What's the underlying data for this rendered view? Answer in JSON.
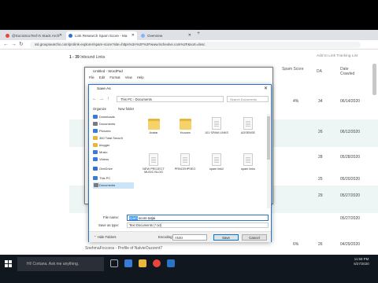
{
  "browser": {
    "tabs": [
      {
        "label": "@SocioSocTech's Stack Arch",
        "active": false,
        "color": "#e8453c"
      },
      {
        "label": "Link Research Spam Score - Ma",
        "active": true,
        "color": "#2f6fd6"
      },
      {
        "label": "Overview",
        "active": false,
        "color": "#8ab4f8"
      }
    ],
    "url": "ssl.groupsearchs.com/prolink-explorer/spam-score?site=https%3A%2F%2Fwww.lscheolve.com%2F&sort=desc"
  },
  "page": {
    "count_range": "1 - 39",
    "count_label": "Inbound Links",
    "add_button": "Add to Link Tracking List",
    "columns": [
      {
        "label": "Spam Score"
      },
      {
        "label": "DA"
      },
      {
        "label": "Date Crawled"
      }
    ],
    "rows": [
      {
        "spam": "4%",
        "da": "34",
        "date": "06/14/2020"
      },
      {
        "spam": "",
        "da": "26",
        "date": "06/12/2020"
      },
      {
        "spam": "",
        "da": "28",
        "date": "05/28/2020"
      },
      {
        "spam": "",
        "da": "25",
        "date": "05/20/2020"
      },
      {
        "spam": "",
        "da": "29",
        "date": "05/27/2020"
      },
      {
        "spam": "",
        "da": "",
        "date": "05/27/2020"
      },
      {
        "spam": "6%",
        "da": "26",
        "date": "04/29/2020"
      }
    ],
    "bottom_row_text": "SnehmaFoccess - Profile of NalvieOuzzent7"
  },
  "wordpad": {
    "title": "Untitled - WordPad",
    "menu": [
      "File",
      "Edit",
      "Format",
      "View",
      "Help"
    ]
  },
  "save_as": {
    "title": "Save As",
    "path": [
      "This PC",
      "Documents"
    ],
    "search_placeholder": "Search Documents",
    "organize": "Organize",
    "new_folder": "New folder",
    "nav_items": [
      {
        "label": "Downloads",
        "color": "#3a7bd5"
      },
      {
        "label": "Documents",
        "color": "#7a7a7a"
      },
      {
        "label": "Pictures",
        "color": "#3a7bd5"
      },
      {
        "label": "360 Total Securit",
        "color": "#e8b63c"
      },
      {
        "label": "blogger",
        "color": "#e8b63c"
      },
      {
        "label": "Music",
        "color": "#3a7bd5"
      },
      {
        "label": "Videos",
        "color": "#3a7bd5"
      },
      {
        "label": "OneDrive",
        "color": "#2f6fd6"
      },
      {
        "label": "This PC",
        "color": "#3a7bd5"
      },
      {
        "label": "Documents",
        "color": "#7a7a7a",
        "selected": true
      }
    ],
    "files": [
      {
        "label": "Avatar",
        "kind": "folder"
      },
      {
        "label": "Youcam",
        "kind": "folder"
      },
      {
        "label": "101 SPAM LINKS",
        "kind": "doc"
      },
      {
        "label": "ADSENSE",
        "kind": "doc"
      },
      {
        "label": "NEW PROJECT MUSIC BLOG",
        "kind": "doc"
      },
      {
        "label": "PRNCEHPSEO",
        "kind": "doc"
      },
      {
        "label": "spam link2",
        "kind": "doc"
      },
      {
        "label": "spam links",
        "kind": "doc"
      }
    ],
    "file_name_label": "File name:",
    "file_name_selected": "spam",
    "file_name_rest": " score tatjai",
    "save_type_label": "Save as type:",
    "save_type": "Text Documents (*.txt)",
    "hide_folders": "Hide Folders",
    "encoding_label": "Encoding:",
    "encoding": "ANSI",
    "save_button": "Save",
    "cancel_button": "Cancel"
  },
  "taskbar": {
    "search": "Hi! Cortana. Ask me anything.",
    "time": "11:59 PM",
    "date": "6/27/2020"
  }
}
